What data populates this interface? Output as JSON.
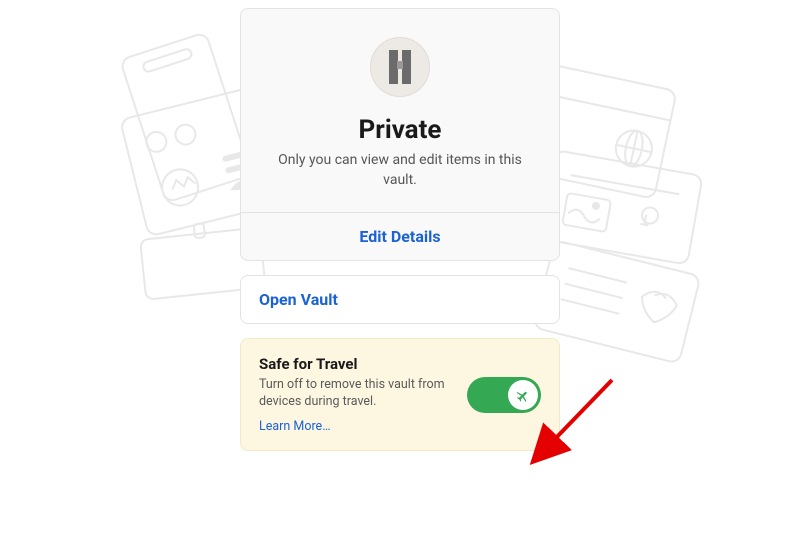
{
  "vault": {
    "title": "Private",
    "description": "Only you can view and edit items in this vault.",
    "edit_label": "Edit Details"
  },
  "open_vault": {
    "label": "Open Vault"
  },
  "travel": {
    "title": "Safe for Travel",
    "description": "Turn off to remove this vault from devices during travel.",
    "learn_more": "Learn More…",
    "enabled": true
  },
  "colors": {
    "link": "#1a62d6",
    "accent": "#34a853",
    "panel_bg": "#fdf7e1"
  }
}
